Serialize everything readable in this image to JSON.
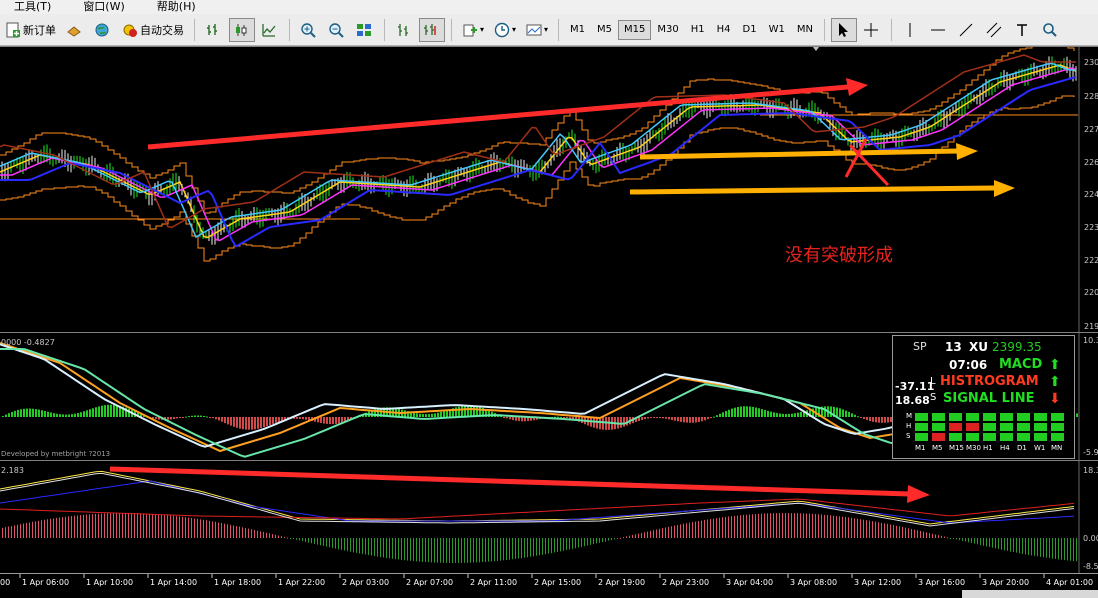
{
  "menubar": {
    "items": [
      "工具(T)",
      "窗口(W)",
      "帮助(H)"
    ]
  },
  "toolbar": {
    "new_order": "新订单",
    "auto_trade": "自动交易",
    "timeframes": [
      "M1",
      "M5",
      "M15",
      "M30",
      "H1",
      "H4",
      "D1",
      "W1",
      "MN"
    ],
    "active_timeframe": "M15",
    "icons": [
      "new-order-icon",
      "history-icon",
      "globe-icon",
      "auto-trade-icon",
      "bar-chart-icon",
      "candlestick-icon",
      "line-chart-icon",
      "zoom-in-icon",
      "zoom-out-icon",
      "tile-windows-icon",
      "chart-shift-icon",
      "autoscroll-icon",
      "indicators-icon",
      "periods-icon",
      "templates-icon",
      "cursor-icon",
      "crosshair-icon",
      "vertical-line-icon",
      "horizontal-line-icon",
      "trendline-icon",
      "text-icon",
      "search-icon"
    ]
  },
  "main_chart": {
    "price_labels": [
      "230",
      "228",
      "227",
      "226",
      "224",
      "223",
      "222",
      "220",
      "219"
    ],
    "annotation": "没有突破形成",
    "colors": {
      "red_arrow": "#ff2a2a",
      "orange_arrow": "#ffb000",
      "annotation": "#e8231e"
    }
  },
  "macd_panel": {
    "header": "0000 -0.4827",
    "credit": "Developed by metbright ?2013",
    "scale": [
      "10.3",
      "-5.9"
    ]
  },
  "dashboard": {
    "sp_label": "SP",
    "sp_value": "13",
    "xu_label": "XU",
    "xu_value": "2399.35",
    "time": "07:06",
    "macd_label": "MACD",
    "histogram_label": "HISTROGRAM",
    "signal_label": "SIGNAL LINE",
    "l_value": "-37.11",
    "l_label": "L",
    "s_value": "18.68",
    "s_label": "S",
    "row_labels": [
      "M",
      "H",
      "S"
    ],
    "timeframes": [
      "M1",
      "M5",
      "M15",
      "M30",
      "H1",
      "H4",
      "D1",
      "W1",
      "MN"
    ],
    "colors": {
      "up": "#22dd22",
      "down": "#ff3b1f",
      "cell": "#22cc22",
      "cell_mark": "#dd2222"
    }
  },
  "lower_panel": {
    "header": "2.183",
    "scale": [
      "18.3",
      "0.00",
      "-8.5"
    ]
  },
  "time_axis": [
    "1 Apr 06:00",
    "1 Apr 10:00",
    "1 Apr 14:00",
    "1 Apr 18:00",
    "1 Apr 22:00",
    "2 Apr 03:00",
    "2 Apr 07:00",
    "2 Apr 11:00",
    "2 Apr 15:00",
    "2 Apr 19:00",
    "2 Apr 23:00",
    "3 Apr 04:00",
    "3 Apr 08:00",
    "3 Apr 12:00",
    "3 Apr 16:00",
    "3 Apr 20:00",
    "4 Apr 01:00"
  ]
}
